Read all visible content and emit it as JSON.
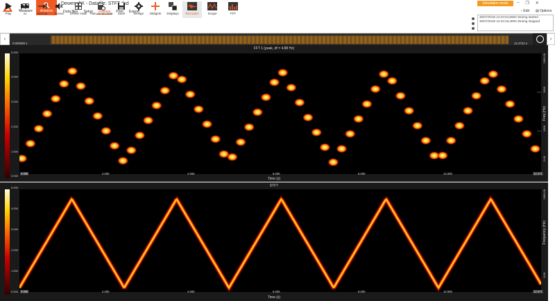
{
  "app": {
    "title": "DewesoftX - Datafile: STFT.dxd",
    "mode_measure": "Measure",
    "mode_analysis": "Analysis",
    "simulation_badge": "Simulation mode",
    "edit_label": "Edit",
    "options_label": "Options",
    "win_minimize": "–",
    "win_restore": "❐",
    "win_close": "✕"
  },
  "menu": [
    {
      "label": "Data files",
      "active": false
    },
    {
      "label": "Setup",
      "active": false
    },
    {
      "label": "Review",
      "active": true
    },
    {
      "label": "Print",
      "active": false
    },
    {
      "label": "Export",
      "active": false
    }
  ],
  "toolbar": {
    "play": "Play",
    "ff": "1x",
    "normal": "Normal",
    "sound": "Sound",
    "offline_math": "Offline math",
    "auto_recalculate": "Auto recalculate",
    "save": "Save",
    "design": "Design",
    "widgets": "Widgets",
    "displays": "Displays",
    "recorder": "Recorder",
    "scope": "Scope",
    "fft": "FFT"
  },
  "log": [
    "30/07/2018 12:23:04,6550 Storing started",
    "30/07/2018 12:23:16,3000 Storing stopped"
  ],
  "overview": {
    "start": "0.000000 s",
    "end": "12.2721 s"
  },
  "colors": {
    "accent": "#ef5a24",
    "simulation": "#f49a1e",
    "panel_bg": "#1a1a1a",
    "plot_bg": "#000000",
    "trace_hot": "#ffdd33",
    "trace_mid": "#ff5a00",
    "trace_cold": "#c40000"
  },
  "fft_panel": {
    "title": "FFT 1 (peak, df = 4.88 Hz)",
    "y_label": "Freq (Hz)",
    "x_label": "Time (s)",
    "x_ticks": [
      "0.000",
      "2.000",
      "4.000",
      "6.000",
      "8.000",
      "10.000"
    ],
    "x_end": "12.271",
    "y_top": "2000.00",
    "y_mid_a": "1500",
    "y_mid_b": "1000",
    "y_bottom": "0.00",
    "cb_top": "5.000",
    "cb_a": "4.000",
    "cb_b": "3.000",
    "cb_c": "2.000",
    "cb_d": "1.000",
    "cb_bottom": "0.000"
  },
  "stft_panel": {
    "title": "STFT",
    "y_label": "Frequency (Hz)",
    "x_label": "Time (s)",
    "x_ticks": [
      "0.000",
      "2.000",
      "4.000",
      "6.000",
      "8.000",
      "10.000"
    ],
    "x_end": "12.271",
    "y_top": "2000.00",
    "y_bottom": "0.00",
    "cb_top": "5.000",
    "cb_a": "4.000",
    "cb_b": "3.000",
    "cb_c": "2.000",
    "cb_d": "1.000",
    "cb_bottom": "0.000"
  }
}
